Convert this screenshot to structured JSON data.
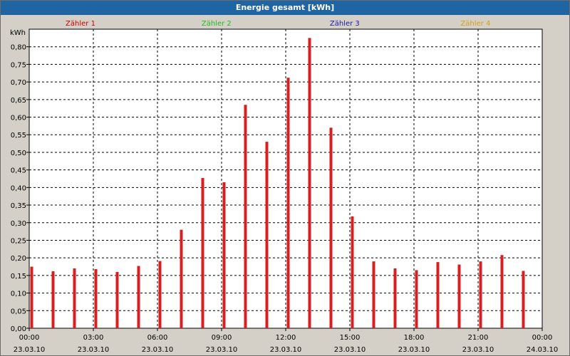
{
  "window": {
    "title": "Energie gesamt [kWh]"
  },
  "chart_data": {
    "type": "bar",
    "title": "Energie gesamt [kWh]",
    "ylabel": "kWh",
    "ylim": [
      0,
      0.85
    ],
    "grid": true,
    "y_ticks": [
      "0,00",
      "0,05",
      "0,10",
      "0,15",
      "0,20",
      "0,25",
      "0,30",
      "0,35",
      "0,40",
      "0,45",
      "0,50",
      "0,55",
      "0,60",
      "0,65",
      "0,70",
      "0,75",
      "0,80"
    ],
    "x_ticks": [
      {
        "time": "00:00",
        "date": "23.03.10"
      },
      {
        "time": "03:00",
        "date": "23.03.10"
      },
      {
        "time": "06:00",
        "date": "23.03.10"
      },
      {
        "time": "09:00",
        "date": "23.03.10"
      },
      {
        "time": "12:00",
        "date": "23.03.10"
      },
      {
        "time": "15:00",
        "date": "23.03.10"
      },
      {
        "time": "18:00",
        "date": "23.03.10"
      },
      {
        "time": "21:00",
        "date": "23.03.10"
      },
      {
        "time": "00:00",
        "date": "24.03.10"
      }
    ],
    "legend": [
      {
        "name": "Zähler 1",
        "color": "#cc0000"
      },
      {
        "name": "Zähler 2",
        "color": "#22bb22"
      },
      {
        "name": "Zähler 3",
        "color": "#1a1aa6"
      },
      {
        "name": "Zähler 4",
        "color": "#d4a017"
      }
    ],
    "bar_color": "#d42020",
    "categories": [
      "00:00",
      "01:00",
      "02:00",
      "03:00",
      "04:00",
      "05:00",
      "06:00",
      "07:00",
      "08:00",
      "09:00",
      "10:00",
      "11:00",
      "12:00",
      "13:00",
      "14:00",
      "15:00",
      "16:00",
      "17:00",
      "18:00",
      "19:00",
      "20:00",
      "21:00",
      "22:00",
      "23:00"
    ],
    "values": [
      0.175,
      0.162,
      0.17,
      0.168,
      0.16,
      0.177,
      0.191,
      0.28,
      0.427,
      0.415,
      0.635,
      0.53,
      0.712,
      0.825,
      0.57,
      0.318,
      0.19,
      0.17,
      0.165,
      0.188,
      0.181,
      0.19,
      0.208,
      0.163
    ]
  }
}
